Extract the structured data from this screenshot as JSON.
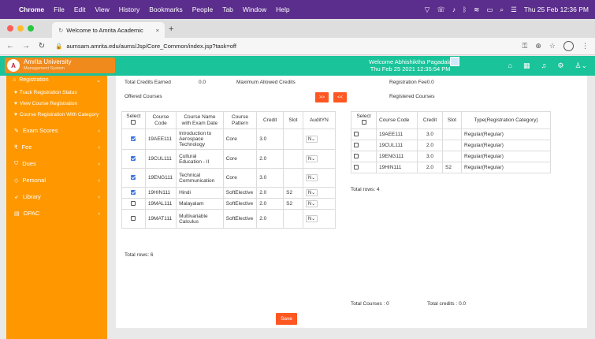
{
  "macbar": {
    "app": "Chrome",
    "menus": [
      "File",
      "Edit",
      "View",
      "History",
      "Bookmarks",
      "People",
      "Tab",
      "Window",
      "Help"
    ],
    "clock": "Thu 25 Feb  12:36 PM"
  },
  "browser": {
    "tab_title": "Welcome to Amrita Academic",
    "url": "aumsam.amrita.edu/aums/Jsp/Core_Common/index.jsp?task=off"
  },
  "header": {
    "logo_line1": "Amrita University",
    "logo_line2": "Management System",
    "welcome_line1": "Welcome Abhishiktha Pagadala",
    "welcome_line2": "Thu Feb 25 2021 12:35:54 PM"
  },
  "sidebar": {
    "registration": "Registration",
    "sub_items": [
      "Track Registration Status",
      "View Course Registration",
      "Course Registration With Category"
    ],
    "items": [
      "Exam Scores",
      "Fee",
      "Dues",
      "Personal",
      "Library",
      "OPAC"
    ]
  },
  "summary": {
    "total_credits_label": "Total Credits Earned",
    "total_credits_value": "0.0",
    "max_credits_label": "Maximum Allowed Credits",
    "reg_fee_label": "Registration Fee0.0",
    "offered_label": "Offered Courses",
    "registered_label": "Registered Courses",
    "move_right": ">>",
    "move_left": "<<"
  },
  "offered": {
    "headers": [
      "Select",
      "Course Code",
      "Course Name with Exam Date",
      "Course Pattern",
      "Credit",
      "Slot",
      "AuditYN"
    ],
    "rows": [
      {
        "checked": true,
        "code": "19AEE111",
        "name": "Introduction to Aerospace Technology",
        "pattern": "Core",
        "credit": "3.0",
        "slot": "",
        "audit": "N"
      },
      {
        "checked": true,
        "code": "19CUL111",
        "name": "Cultural Education - II",
        "pattern": "Core",
        "credit": "2.0",
        "slot": "",
        "audit": "N"
      },
      {
        "checked": true,
        "code": "19ENG111",
        "name": "Technical Communication",
        "pattern": "Core",
        "credit": "3.0",
        "slot": "",
        "audit": "N"
      },
      {
        "checked": true,
        "code": "19HIN111",
        "name": "Hindi",
        "pattern": "SoftElective",
        "credit": "2.0",
        "slot": "S2",
        "audit": "N"
      },
      {
        "checked": false,
        "code": "19MAL111",
        "name": "Malayalam",
        "pattern": "SoftElective",
        "credit": "2.0",
        "slot": "S2",
        "audit": "N"
      },
      {
        "checked": false,
        "code": "19MAT111",
        "name": "Multivariable Calculus",
        "pattern": "SoftElective",
        "credit": "2.0",
        "slot": "",
        "audit": "N"
      }
    ],
    "total_rows": "Total rows: 6"
  },
  "registered": {
    "headers": [
      "Select",
      "Course Code",
      "Credit",
      "Slot",
      "Type(Registration Category)"
    ],
    "rows": [
      {
        "code": "19AEE111",
        "credit": "3.0",
        "slot": "",
        "type": "Regular(Regular)"
      },
      {
        "code": "19CUL111",
        "credit": "2.0",
        "slot": "",
        "type": "Regular(Regular)"
      },
      {
        "code": "19ENG111",
        "credit": "3.0",
        "slot": "",
        "type": "Regular(Regular)"
      },
      {
        "code": "19HIN111",
        "credit": "2.0",
        "slot": "S2",
        "type": "Regular(Regular)"
      }
    ],
    "total_rows": "Total rows: 4",
    "total_courses": "Total Courses : 0",
    "total_credits": "Total credits : 0.0"
  },
  "save_label": "Save",
  "colors": {
    "header": "#1ac39a",
    "sidebar": "#ff9800",
    "button": "#ff5722",
    "menubar": "#5b2d8c"
  }
}
